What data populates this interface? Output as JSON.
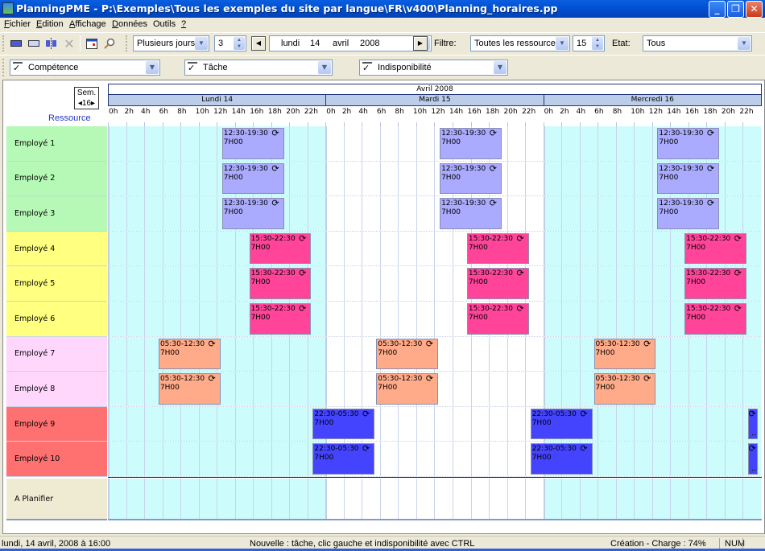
{
  "window": {
    "title": "PlanningPME - P:\\Exemples\\Tous les exemples du site par langue\\FR\\v400\\Planning_horaires.pp",
    "buttons": {
      "minimize": "_",
      "maximize": "❐",
      "close": "✕"
    }
  },
  "menu": [
    {
      "label": "Fichier",
      "accel": "F",
      "rest": "ichier"
    },
    {
      "label": "Edition",
      "accel": "E",
      "rest": "dition"
    },
    {
      "label": "Affichage",
      "accel": "A",
      "rest": "ffichage"
    },
    {
      "label": "Données",
      "accel": "D",
      "rest": "onnées"
    },
    {
      "label": "Outils",
      "accel": "",
      "rest": "Outils"
    },
    {
      "label": "?",
      "accel": "?",
      "rest": ""
    }
  ],
  "toolbar": {
    "icons": [
      "resource-view-icon",
      "task-view-icon",
      "split-icon",
      "delete-icon",
      "calendar-icon",
      "zoom-icon"
    ],
    "view_mode": "Plusieurs jours",
    "days_count": "3",
    "date": {
      "weekday": "lundi",
      "day": "14",
      "month": "avril",
      "year": "2008"
    },
    "filter_label": "Filtre:",
    "filter_value": "Toutes les ressources",
    "filter_count": "15",
    "state_label": "Etat:",
    "state_value": "Tous",
    "nav_prev": "◀",
    "nav_next": "▶"
  },
  "filters": [
    {
      "label": "Compétence",
      "checked": true
    },
    {
      "label": "Tâche",
      "checked": true
    },
    {
      "label": "Indisponibilité",
      "checked": true
    }
  ],
  "planning": {
    "week_label": "Sem.",
    "week_number": "◂16▸",
    "resource_header": "Ressource",
    "month": "Avril 2008",
    "days": [
      "Lundi 14",
      "Mardi 15",
      "Mercredi 16"
    ],
    "hours": [
      "0h",
      "2h",
      "4h",
      "6h",
      "8h",
      "10h",
      "12h",
      "14h",
      "16h",
      "18h",
      "20h",
      "22h"
    ],
    "colors": {
      "workday_bg": "#ccfcfc",
      "offday_bg": "#ffffff",
      "grid_line": "#c9d3ea"
    },
    "resources": [
      {
        "name": "Employé 1",
        "color": "#b6f8b6"
      },
      {
        "name": "Employé 2",
        "color": "#b6f8b6"
      },
      {
        "name": "Employé 3",
        "color": "#b6f8b6"
      },
      {
        "name": "Employé 4",
        "color": "#ffff80"
      },
      {
        "name": "Employé 5",
        "color": "#ffff80"
      },
      {
        "name": "Employé 6",
        "color": "#ffff80"
      },
      {
        "name": "Employé 7",
        "color": "#ffd6fc"
      },
      {
        "name": "Employé 8",
        "color": "#ffd6fc"
      },
      {
        "name": "Employé 9",
        "color": "#ff7070"
      },
      {
        "name": "Employé 10",
        "color": "#ff7070"
      }
    ],
    "unplanned": {
      "name": "A Planifier",
      "color": "#efebd3"
    },
    "shifts": [
      {
        "rows": [
          0,
          1,
          2
        ],
        "label": "12:30-19:30",
        "duration": "7H00",
        "start": 12.5,
        "end": 19.5,
        "color": "#aaaaff",
        "days": [
          0,
          1,
          2
        ]
      },
      {
        "rows": [
          3,
          4,
          5
        ],
        "label": "15:30-22:30",
        "duration": "7H00",
        "start": 15.5,
        "end": 22.5,
        "color": "#ff4499",
        "days": [
          0,
          1,
          2
        ]
      },
      {
        "rows": [
          6,
          7
        ],
        "label": "05:30-12:30",
        "duration": "7H00",
        "start": 5.5,
        "end": 12.5,
        "color": "#ffaa88",
        "days": [
          0,
          1,
          2
        ]
      },
      {
        "rows": [
          8,
          9
        ],
        "label": "22:30-05:30",
        "duration": "7H00",
        "start": 22.5,
        "end": 29.5,
        "color": "#4444ff",
        "days": [
          0,
          1,
          2
        ]
      }
    ]
  },
  "status": {
    "datetime": "lundi, 14 avril, 2008 à 16:00",
    "hint": "Nouvelle : tâche, clic gauche et indisponibilité avec CTRL",
    "mode": "Création - Charge : 74%",
    "num": "NUM"
  }
}
